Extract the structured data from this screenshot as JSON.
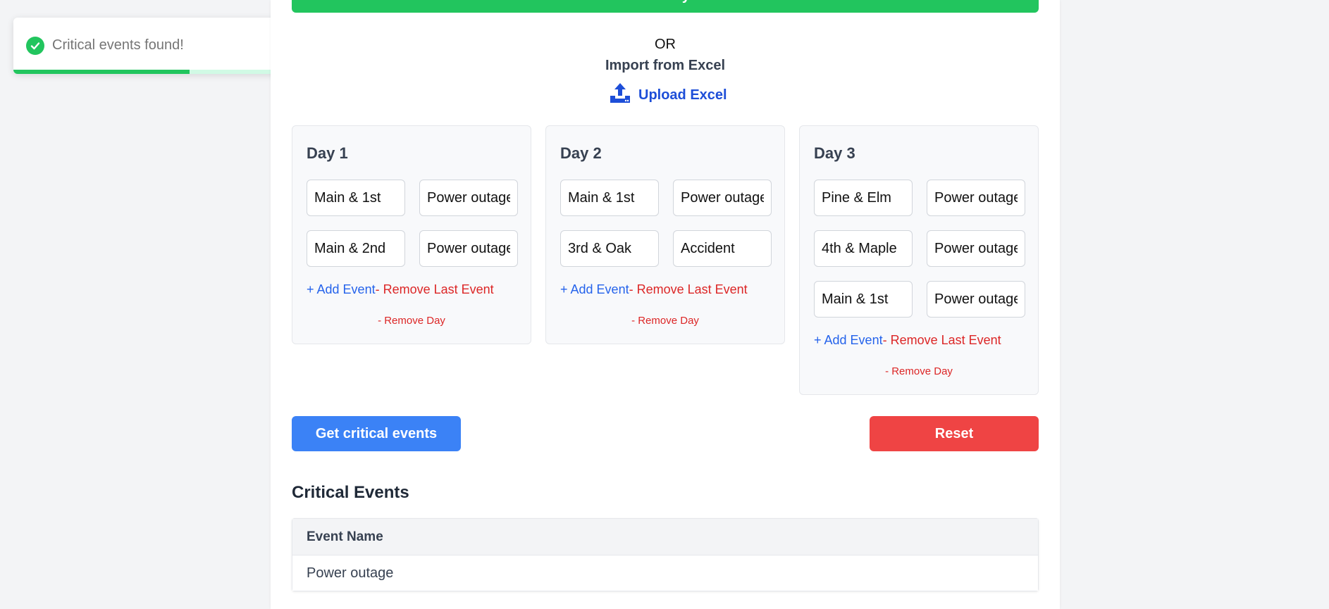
{
  "toast": {
    "message": "Critical events found!",
    "close": "×",
    "progress": 0.64
  },
  "header": {
    "add_days_label": "Add Days",
    "or_text": "OR",
    "import_title": "Import from Excel",
    "upload_label": "Upload Excel"
  },
  "days": [
    {
      "title": "Day 1",
      "events": [
        {
          "location": "Main & 1st",
          "event": "Power outage"
        },
        {
          "location": "Main & 2nd",
          "event": "Power outage"
        }
      ]
    },
    {
      "title": "Day 2",
      "events": [
        {
          "location": "Main & 1st",
          "event": "Power outage"
        },
        {
          "location": "3rd & Oak",
          "event": "Accident"
        }
      ]
    },
    {
      "title": "Day 3",
      "events": [
        {
          "location": "Pine & Elm",
          "event": "Power outage"
        },
        {
          "location": "4th & Maple",
          "event": "Power outage"
        },
        {
          "location": "Main & 1st",
          "event": "Power outage"
        }
      ]
    }
  ],
  "day_actions": {
    "add_event": "+ Add Event",
    "remove_last_event": "- Remove Last Event",
    "remove_day": "- Remove Day"
  },
  "buttons": {
    "get_critical": "Get critical events",
    "reset": "Reset"
  },
  "critical_events": {
    "title": "Critical Events",
    "column": "Event Name",
    "rows": [
      "Power outage"
    ]
  },
  "colors": {
    "success": "#22c55e",
    "primary": "#3b82f6",
    "danger": "#ef4444",
    "link": "#2563eb"
  }
}
